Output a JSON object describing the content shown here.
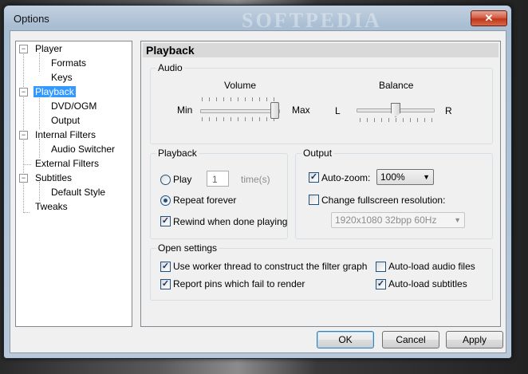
{
  "window": {
    "title": "Options",
    "close_symbol": "✕",
    "watermark": "SOFTPEDIA"
  },
  "tree": {
    "items": [
      {
        "label": "Player",
        "expandable": true
      },
      {
        "label": "Formats"
      },
      {
        "label": "Keys"
      },
      {
        "label": "Playback",
        "expandable": true,
        "selected": true
      },
      {
        "label": "DVD/OGM"
      },
      {
        "label": "Output"
      },
      {
        "label": "Internal Filters",
        "expandable": true
      },
      {
        "label": "Audio Switcher"
      },
      {
        "label": "External Filters"
      },
      {
        "label": "Subtitles",
        "expandable": true
      },
      {
        "label": "Default Style"
      },
      {
        "label": "Tweaks"
      }
    ]
  },
  "panel": {
    "title": "Playback",
    "audio": {
      "group_label": "Audio",
      "volume_label": "Volume",
      "volume_min": "Min",
      "volume_max": "Max",
      "volume_level": 1.0,
      "balance_label": "Balance",
      "balance_left": "L",
      "balance_right": "R",
      "balance_level": 0.5
    },
    "playback": {
      "group_label": "Playback",
      "play_label": "Play",
      "play_times_value": "1",
      "times_label": "time(s)",
      "repeat_label": "Repeat forever",
      "repeat_selected": true,
      "rewind_label": "Rewind when done playing",
      "rewind_checked": true
    },
    "output": {
      "group_label": "Output",
      "autozoom_label": "Auto-zoom:",
      "autozoom_checked": true,
      "autozoom_value": "100%",
      "fullscreen_label": "Change fullscreen resolution:",
      "fullscreen_checked": false,
      "resolution_value": "1920x1080 32bpp 60Hz"
    },
    "open_settings": {
      "group_label": "Open settings",
      "worker_thread_label": "Use worker thread to construct the filter graph",
      "worker_thread_checked": true,
      "report_pins_label": "Report pins which fail to render",
      "report_pins_checked": true,
      "autoload_audio_label": "Auto-load audio files",
      "autoload_audio_checked": false,
      "autoload_subs_label": "Auto-load subtitles",
      "autoload_subs_checked": true
    }
  },
  "buttons": {
    "ok": "OK",
    "cancel": "Cancel",
    "apply": "Apply"
  },
  "check_glyph": "✓",
  "combo_arrow": "▼"
}
